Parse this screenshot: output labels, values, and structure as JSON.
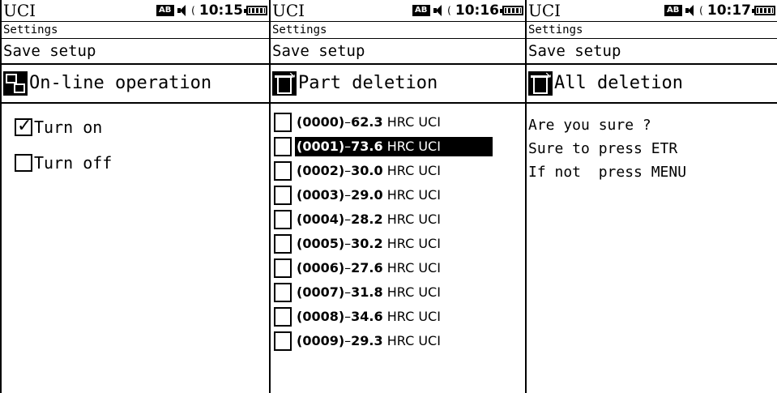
{
  "screens": [
    {
      "app_title": "UCI",
      "time": "10:15",
      "breadcrumb": "Settings",
      "save_bar": "Save setup",
      "header_icon": "online-operation-icon",
      "header_title": "On-line operation",
      "options": [
        {
          "label": "Turn on",
          "checked": true
        },
        {
          "label": "Turn off",
          "checked": false
        }
      ]
    },
    {
      "app_title": "UCI",
      "time": "10:16",
      "breadcrumb": "Settings",
      "save_bar": "Save setup",
      "header_icon": "trash-icon",
      "header_title": "Part deletion",
      "records": [
        {
          "id": "(0000)",
          "value": "62.3",
          "unit": "HRC UCI",
          "selected": false
        },
        {
          "id": "(0001)",
          "value": "73.6",
          "unit": "HRC UCI",
          "selected": true
        },
        {
          "id": "(0002)",
          "value": "30.0",
          "unit": "HRC UCI",
          "selected": false
        },
        {
          "id": "(0003)",
          "value": "29.0",
          "unit": "HRC UCI",
          "selected": false
        },
        {
          "id": "(0004)",
          "value": "28.2",
          "unit": "HRC UCI",
          "selected": false
        },
        {
          "id": "(0005)",
          "value": "30.2",
          "unit": "HRC UCI",
          "selected": false
        },
        {
          "id": "(0006)",
          "value": "27.6",
          "unit": "HRC UCI",
          "selected": false
        },
        {
          "id": "(0007)",
          "value": "31.8",
          "unit": "HRC UCI",
          "selected": false
        },
        {
          "id": "(0008)",
          "value": "34.6",
          "unit": "HRC UCI",
          "selected": false
        },
        {
          "id": "(0009)",
          "value": "29.3",
          "unit": "HRC UCI",
          "selected": false
        }
      ]
    },
    {
      "app_title": "UCI",
      "time": "10:17",
      "breadcrumb": "Settings",
      "save_bar": "Save setup",
      "header_icon": "trash-all-icon",
      "header_title": "All deletion",
      "confirm_lines": [
        "Are you sure ?",
        "Sure to press ETR",
        "If not  press MENU"
      ]
    }
  ],
  "status_icons": {
    "input_mode": "AB",
    "sound": "speaker-icon",
    "battery": "battery-icon"
  }
}
